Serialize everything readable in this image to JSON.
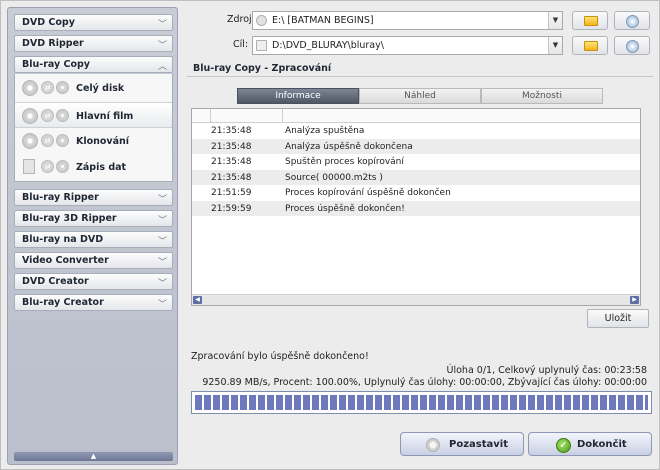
{
  "sidebar": {
    "menu": [
      {
        "label": "DVD Copy",
        "chevron": "chevron-down-icon"
      },
      {
        "label": "DVD Ripper",
        "chevron": "chevron-down-icon"
      },
      {
        "label": "Blu-ray Copy",
        "chevron": "chevron-up-icon"
      },
      {
        "label": "Blu-ray Ripper",
        "chevron": "chevron-down-icon"
      },
      {
        "label": "Blu-ray 3D Ripper",
        "chevron": "chevron-down-icon"
      },
      {
        "label": "Blu-ray na DVD",
        "chevron": "chevron-down-icon"
      },
      {
        "label": "Video Converter",
        "chevron": "chevron-down-icon"
      },
      {
        "label": "DVD Creator",
        "chevron": "chevron-down-icon"
      },
      {
        "label": "Blu-ray Creator",
        "chevron": "chevron-down-icon"
      }
    ],
    "sub_items": [
      {
        "label": "Celý disk"
      },
      {
        "label": "Hlavní film",
        "active": true
      },
      {
        "label": "Klonování"
      },
      {
        "label": "Zápis dat"
      }
    ]
  },
  "source": {
    "label": "Zdroj:",
    "value": "E:\\ [BATMAN BEGINS]"
  },
  "target": {
    "label": "Cíl:",
    "value": "D:\\DVD_BLURAY\\bluray\\"
  },
  "section_title": "Blu-ray Copy  -  Zpracování",
  "tabs": [
    "Informace",
    "Náhled",
    "Možnosti"
  ],
  "log": [
    {
      "time": "21:35:48",
      "msg": "Analýza spuštěna"
    },
    {
      "time": "21:35:48",
      "msg": "Analýza úspěšně dokončena"
    },
    {
      "time": "21:35:48",
      "msg": "Spuštěn proces kopírování"
    },
    {
      "time": "21:35:48",
      "msg": "Source( 00000.m2ts )"
    },
    {
      "time": "21:51:59",
      "msg": "Proces kopírování úspěšně dokončen"
    },
    {
      "time": "21:59:59",
      "msg": "Proces úspěšně dokončen!"
    }
  ],
  "save_label": "Uložit",
  "status_message": "Zpracování bylo úspěšně dokončeno!",
  "task_info": "Úloha 0/1, Celkový uplynulý čas: 00:23:58",
  "stats": "9250.89 MB/s,  Procent: 100.00%,  Uplynulý čas úlohy: 00:00:00,  Zbývající čas úlohy: 00:00:00",
  "progress_percent": 100,
  "buttons": {
    "pause": "Pozastavit",
    "finish": "Dokončit"
  },
  "colors": {
    "progress": "#6d78bd",
    "active_tab": "#5a6171",
    "finish_icon": "#4a9a17"
  }
}
